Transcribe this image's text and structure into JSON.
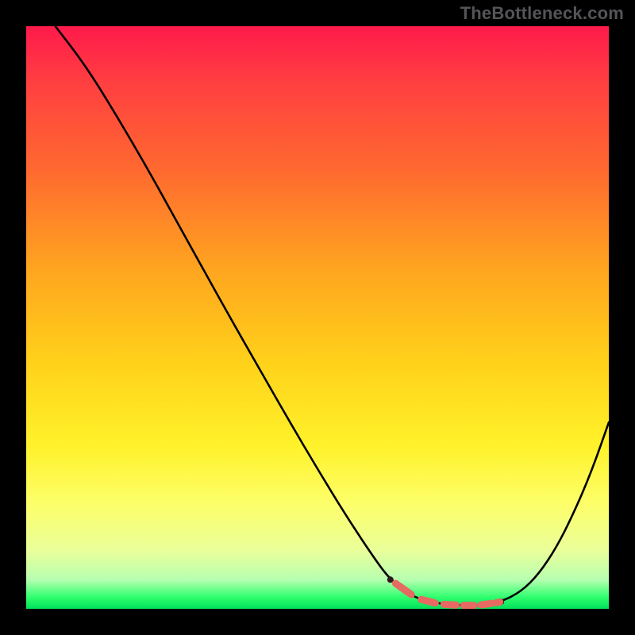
{
  "watermark": "TheBottleneck.com",
  "colors": {
    "frame": "#000000",
    "curve": "#000000",
    "marker": "#e66a62",
    "gradient_top": "#ff1a4b",
    "gradient_bottom": "#00e05a"
  },
  "chart_data": {
    "type": "line",
    "title": "",
    "xlabel": "",
    "ylabel": "",
    "xlim": [
      0,
      1
    ],
    "ylim": [
      0,
      1
    ],
    "x": [
      0.05,
      0.1,
      0.15,
      0.2,
      0.25,
      0.3,
      0.35,
      0.4,
      0.45,
      0.5,
      0.55,
      0.6,
      0.625,
      0.66,
      0.7,
      0.74,
      0.78,
      0.815,
      0.85,
      0.88,
      0.91,
      0.94,
      0.97,
      1.0
    ],
    "y": [
      1.0,
      0.935,
      0.855,
      0.77,
      0.68,
      0.59,
      0.5,
      0.412,
      0.325,
      0.24,
      0.158,
      0.083,
      0.05,
      0.022,
      0.01,
      0.006,
      0.006,
      0.012,
      0.03,
      0.06,
      0.105,
      0.165,
      0.235,
      0.32
    ],
    "markers": {
      "x": [
        0.625,
        0.67,
        0.71,
        0.745,
        0.775,
        0.805,
        0.815
      ],
      "y": [
        0.05,
        0.018,
        0.008,
        0.006,
        0.006,
        0.01,
        0.012
      ]
    },
    "note": "y=1 is top of colored area, y=0 is bottom; x=0 left edge, x=1 right edge"
  }
}
